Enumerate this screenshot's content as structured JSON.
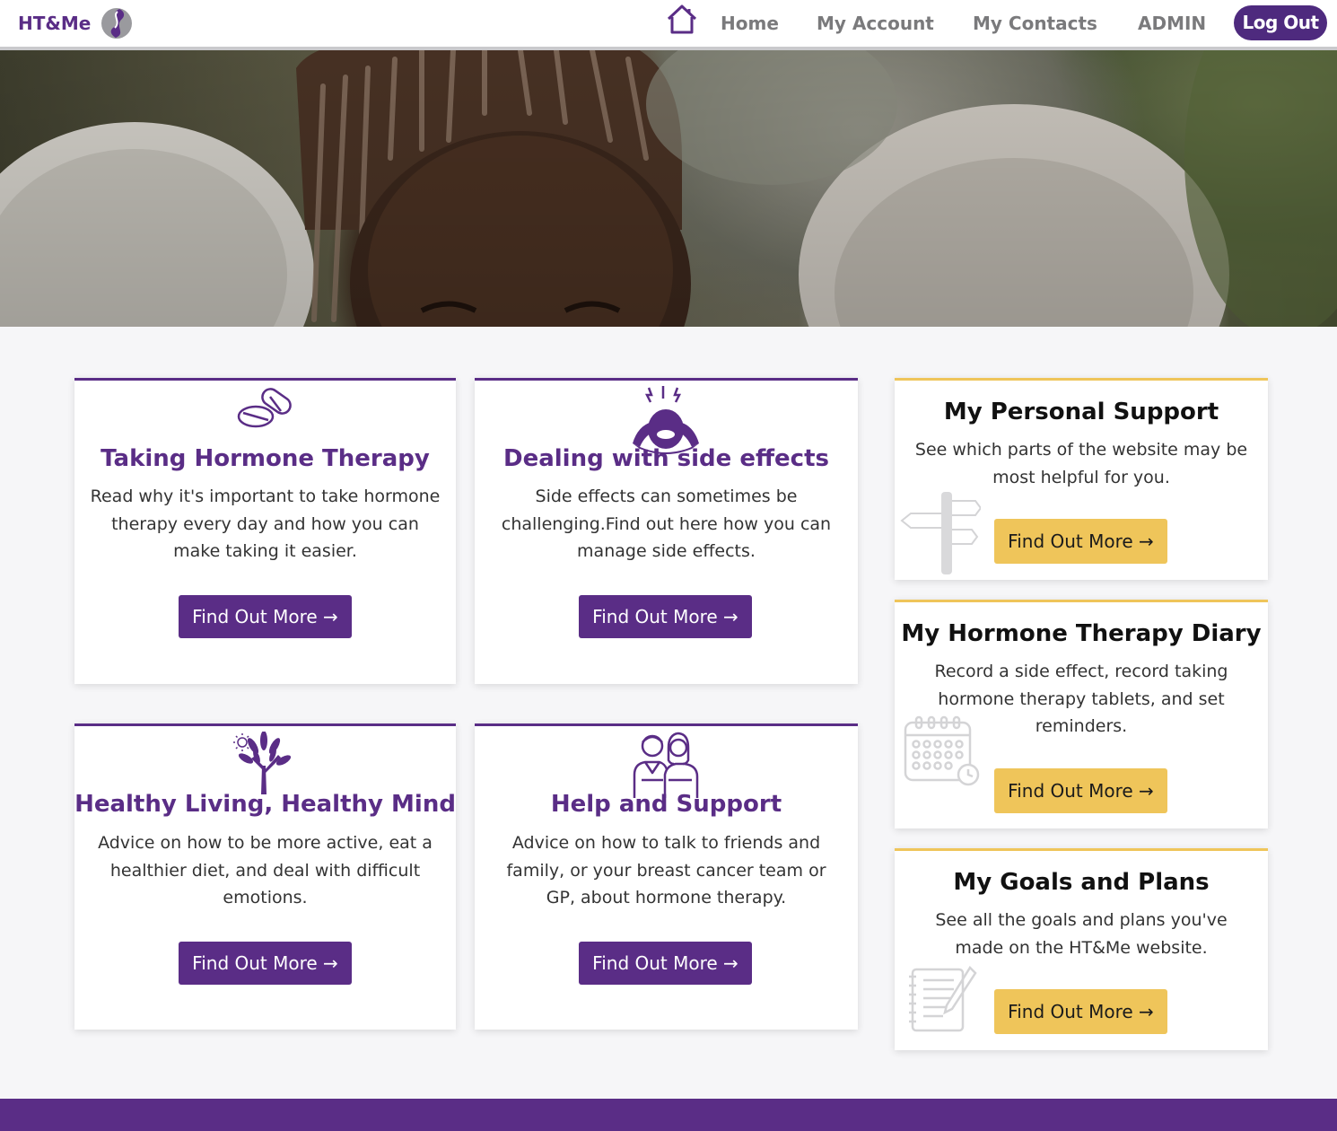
{
  "brand": {
    "name": "HT&Me",
    "logo_icon": "ht-me-logo-icon"
  },
  "nav": {
    "home_icon": "home-icon",
    "links": [
      "Home",
      "My Account",
      "My Contacts",
      "ADMIN"
    ],
    "logout_label": "Log Out"
  },
  "hero": {
    "alt": "",
    "image": "three-women-hero-photo"
  },
  "main_cards": [
    {
      "icon": "pills-icon",
      "title": "Taking Hormone Therapy",
      "text": "Read why it's important to take hormone therapy every day and how you can make taking it easier.",
      "button": "Find Out More →"
    },
    {
      "icon": "headache-person-icon",
      "title": "Dealing with side effects",
      "text": "Side effects can sometimes be challenging.Find out here how you can manage side effects.",
      "button": "Find Out More →"
    },
    {
      "icon": "tree-icon",
      "title": "Healthy Living, Healthy Mind",
      "text": "Advice on how to be more active, eat a healthier diet, and deal with difficult emotions.",
      "button": "Find Out More →"
    },
    {
      "icon": "people-support-icon",
      "title": "Help and Support",
      "text": "Advice on how to talk to friends and family, or your breast cancer team or GP, about hormone therapy.",
      "button": "Find Out More →"
    }
  ],
  "side_cards": [
    {
      "icon": "signpost-icon",
      "title": "My Personal Support",
      "text": "See which parts of the website may be most helpful for you.",
      "button": "Find Out More →"
    },
    {
      "icon": "calendar-clock-icon",
      "title": "My Hormone Therapy Diary",
      "text": "Record a side effect, record taking hormone therapy tablets, and set reminders.",
      "button": "Find Out More →"
    },
    {
      "icon": "notepad-icon",
      "title": "My Goals and Plans",
      "text": "See all the goals and plans you've made on the HT&Me website.",
      "button": "Find Out More →"
    }
  ],
  "colors": {
    "brand_purple": "#5a2d86",
    "nav_button": "#4e2a7e",
    "accent_yellow": "#efc55a",
    "nav_text": "#7a7a7c"
  }
}
